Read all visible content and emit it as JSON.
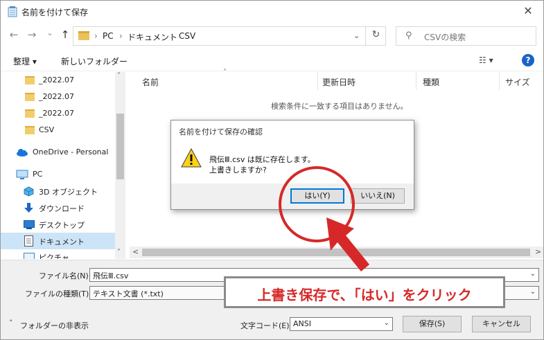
{
  "window": {
    "title": "名前を付けて保存",
    "close_glyph": "✕"
  },
  "address": {
    "back_glyph": "←",
    "forward_glyph": "→",
    "recent_glyph": "⌄",
    "up_glyph": "↑",
    "crumbs": [
      "PC",
      "ドキュメント",
      "CSV"
    ],
    "separator": "›",
    "dropdown_glyph": "⌄",
    "refresh_glyph": "↻",
    "search_placeholder": "CSVの検索"
  },
  "toolbar": {
    "organize": "整理 ▾",
    "new_folder": "新しいフォルダー",
    "view_glyph": "☷ ▾",
    "help_glyph": "?"
  },
  "nav": {
    "items": [
      {
        "label": "_2022.07",
        "icon": "folder-icon"
      },
      {
        "label": "_2022.07",
        "icon": "folder-icon"
      },
      {
        "label": "_2022.07",
        "icon": "folder-icon"
      },
      {
        "label": "CSV",
        "icon": "folder-icon"
      },
      {
        "label": "OneDrive - Personal",
        "icon": "cloud-icon"
      },
      {
        "label": "PC",
        "icon": "pc-icon"
      },
      {
        "label": "3D オブジェクト",
        "icon": "3d-objects-icon"
      },
      {
        "label": "ダウンロード",
        "icon": "download-icon"
      },
      {
        "label": "デスクトップ",
        "icon": "desktop-icon"
      },
      {
        "label": "ドキュメント",
        "icon": "document-icon"
      },
      {
        "label": "ピクチャ",
        "icon": "pictures-icon"
      }
    ],
    "selected_label": "ドキュメント",
    "scroll_up": "˄",
    "scroll_down": "˅"
  },
  "files": {
    "columns": [
      "名前",
      "更新日時",
      "種類",
      "サイズ"
    ],
    "sort_glyph": "˄",
    "empty_message": "検索条件に一致する項目はありません。",
    "hscroll_left": "<",
    "hscroll_right": ">"
  },
  "form": {
    "filename_label": "ファイル名(N):",
    "filename_value": "飛伝Ⅲ.csv",
    "filetype_label": "ファイルの種類(T):",
    "filetype_value": "テキスト文書 (*.txt)",
    "hide_folders": "フォルダーの非表示",
    "hide_folders_glyph": "˄",
    "encoding_label": "文字コード(E):",
    "encoding_value": "ANSI",
    "save_button": "保存(S)",
    "cancel_button": "キャンセル"
  },
  "dialog": {
    "title": "名前を付けて保存の確認",
    "message_line1": "飛伝Ⅲ.csv は既に存在します。",
    "message_line2": "上書きしますか?",
    "yes_button": "はい(Y)",
    "no_button": "いいえ(N)"
  },
  "annotation": {
    "text": "上書き保存で、「はい」をクリック",
    "color": "#d62828"
  }
}
